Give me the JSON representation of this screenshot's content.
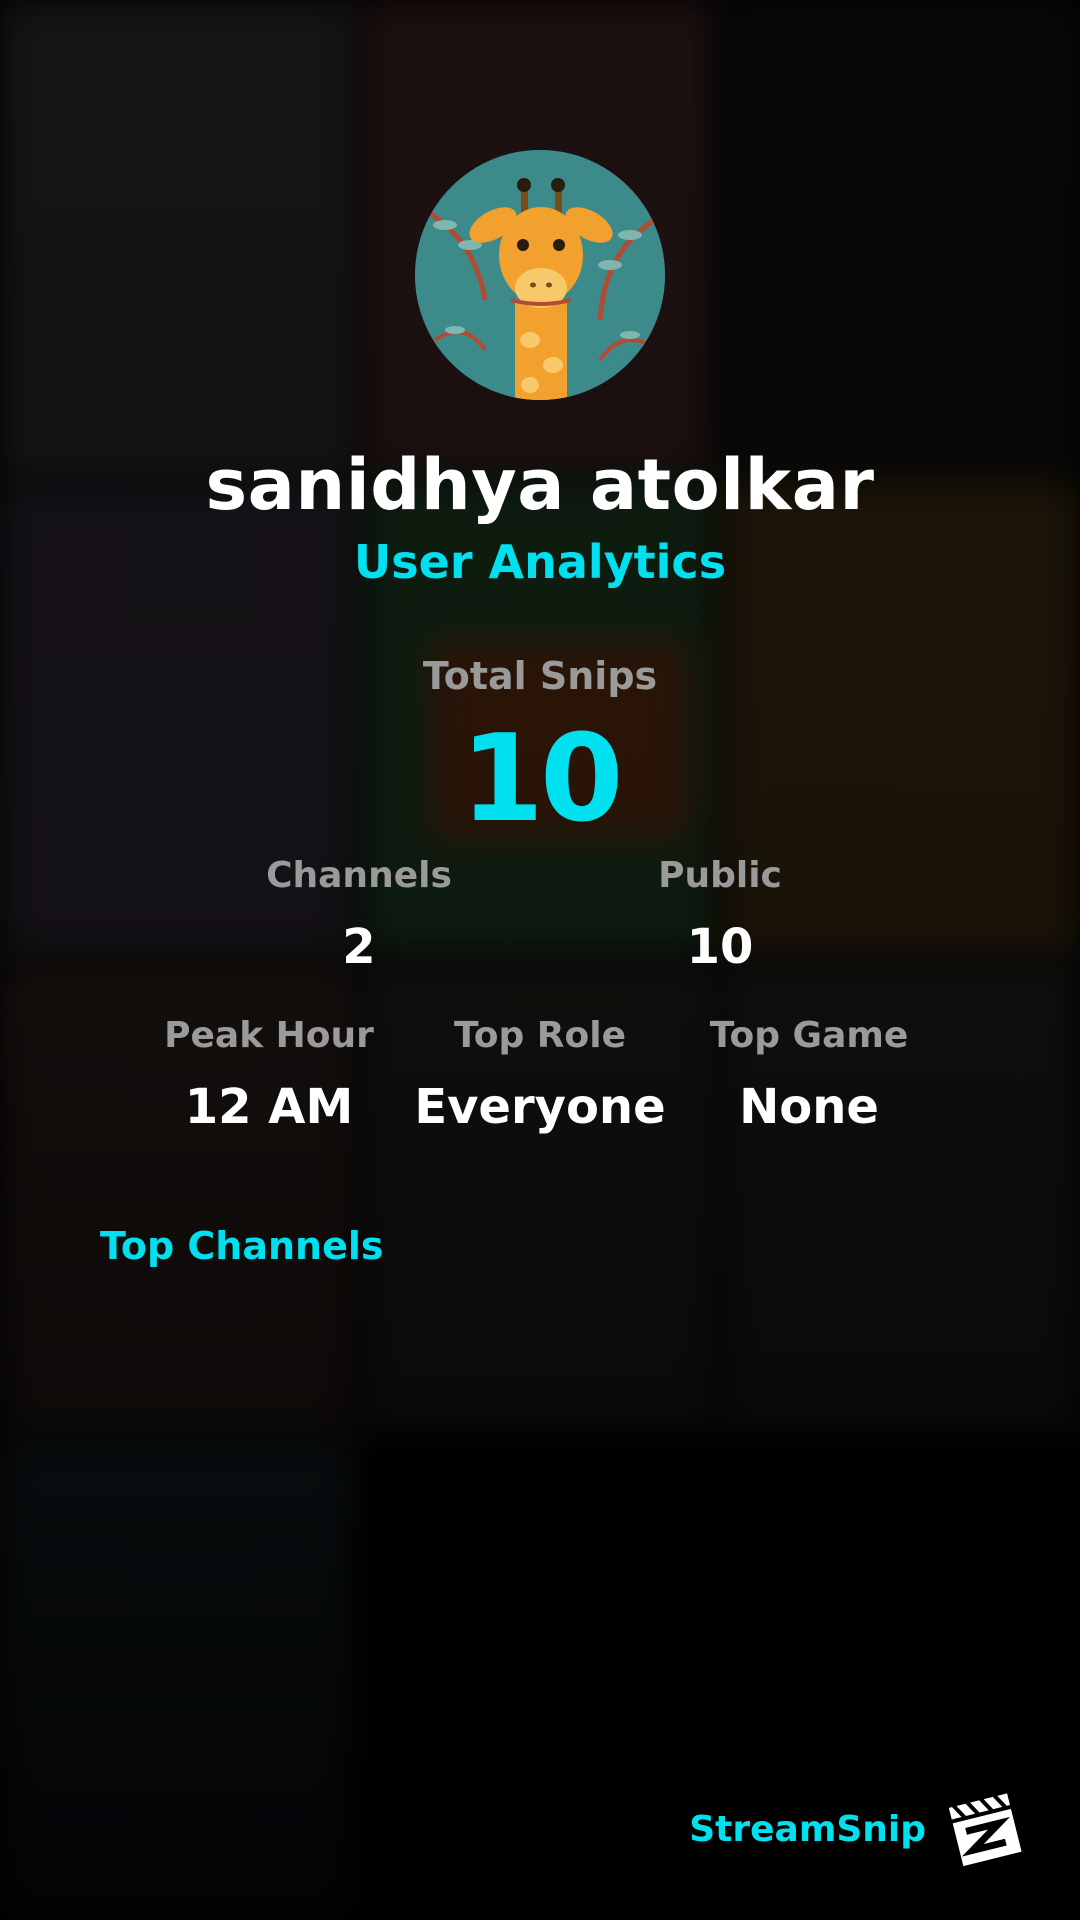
{
  "profile": {
    "username": "sanidhya atolkar",
    "subtitle": "User Analytics",
    "avatar_icon": "giraffe-avatar"
  },
  "totals": {
    "total_snips_label": "Total Snips",
    "total_snips_value": "10"
  },
  "stats_row1": {
    "channels_label": "Channels",
    "channels_value": "2",
    "public_label": "Public",
    "public_value": "10"
  },
  "stats_row2": {
    "peak_hour_label": "Peak Hour",
    "peak_hour_value": "12 AM",
    "top_role_label": "Top Role",
    "top_role_value": "Everyone",
    "top_game_label": "Top Game",
    "top_game_value": "None"
  },
  "sections": {
    "top_channels_heading": "Top Channels"
  },
  "branding": {
    "name": "StreamSnip",
    "logo_icon": "clapperboard-logo-icon"
  },
  "colors": {
    "accent": "#00e0ee",
    "label_gray": "#9a9a9a",
    "background": "#000000",
    "text": "#ffffff"
  }
}
